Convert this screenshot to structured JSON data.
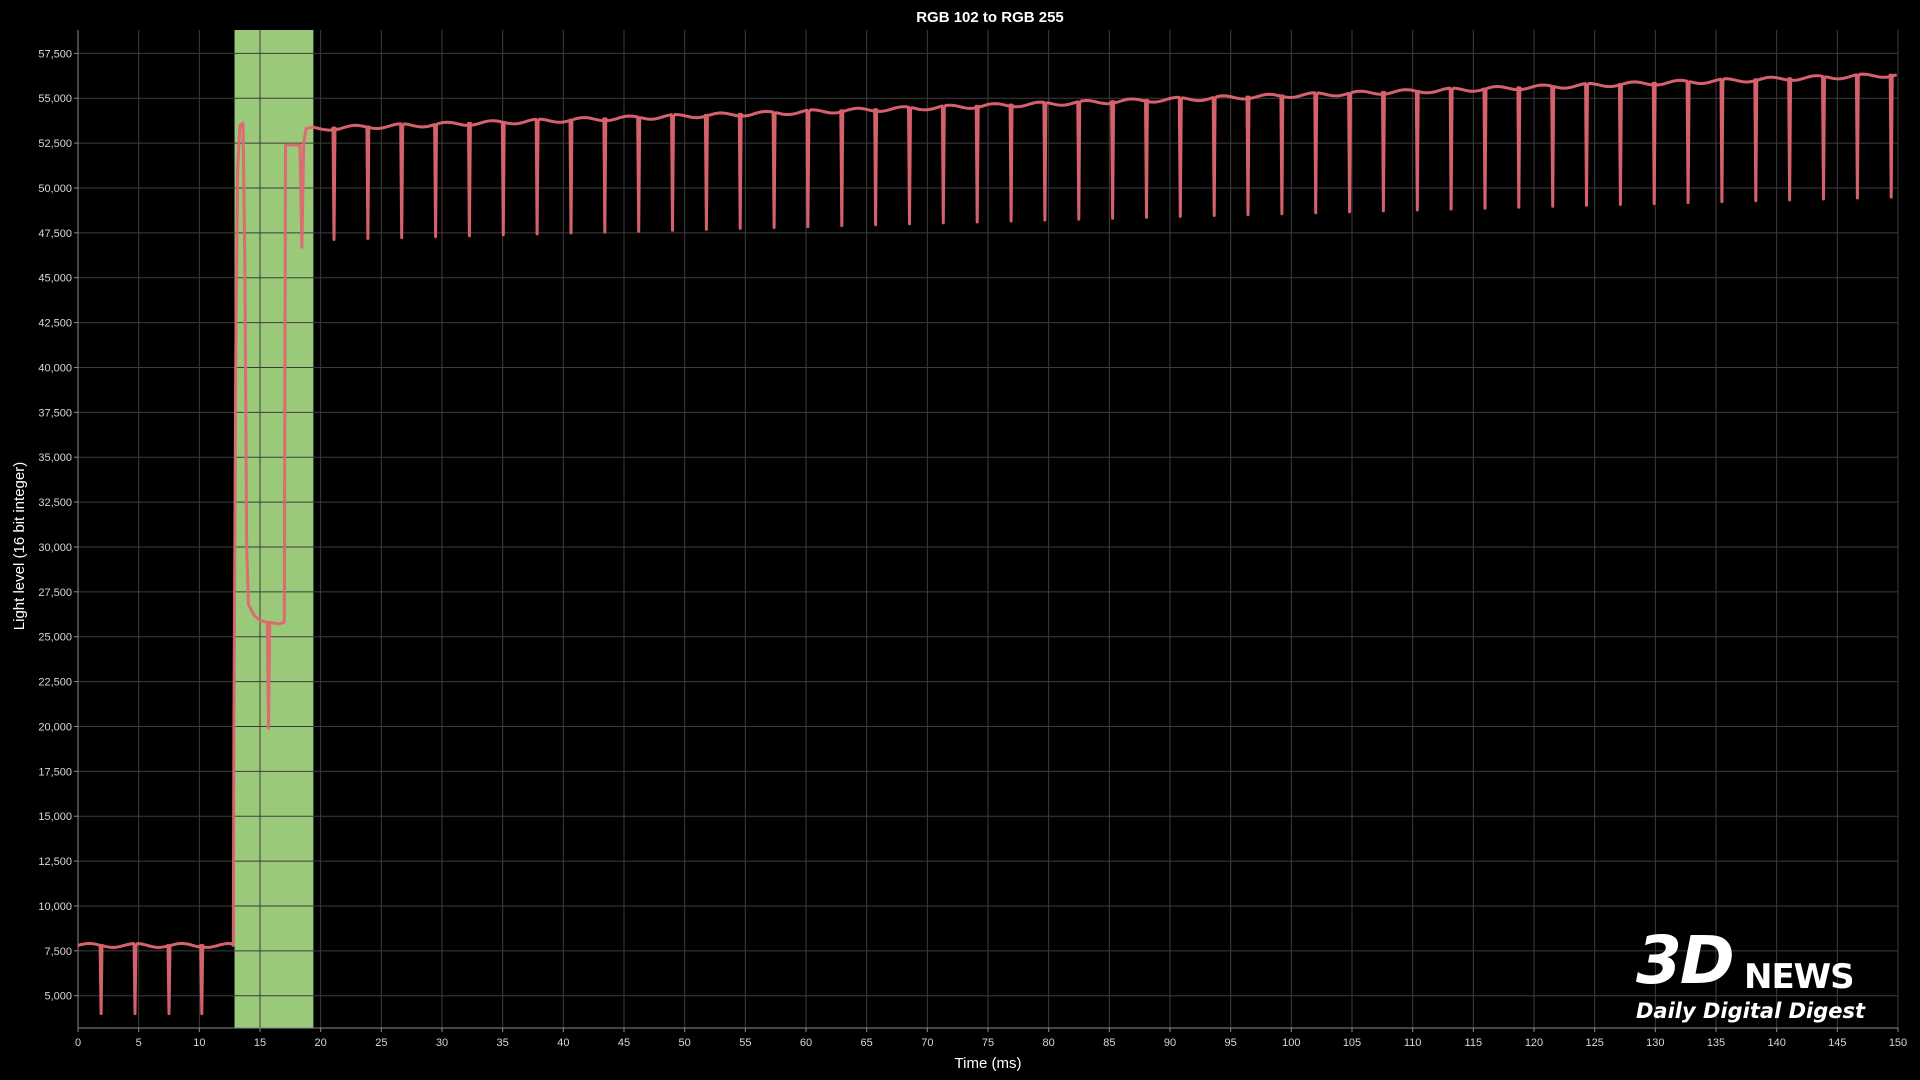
{
  "chart_data": {
    "type": "line",
    "title": "RGB 102 to RGB 255",
    "xlabel": "Time (ms)",
    "ylabel": "Light level (16 bit integer)",
    "xlim": [
      0,
      150
    ],
    "ylim": [
      3200,
      58800
    ],
    "x_ticks": [
      0,
      5,
      10,
      15,
      20,
      25,
      30,
      35,
      40,
      45,
      50,
      55,
      60,
      65,
      70,
      75,
      80,
      85,
      90,
      95,
      100,
      105,
      110,
      115,
      120,
      125,
      130,
      135,
      140,
      145,
      150
    ],
    "y_ticks": [
      5000,
      7500,
      10000,
      12500,
      15000,
      17500,
      20000,
      22500,
      25000,
      27500,
      30000,
      32500,
      35000,
      37500,
      40000,
      42500,
      45000,
      47500,
      50000,
      52500,
      55000,
      57500
    ],
    "y_tick_labels": [
      "5,000",
      "7,500",
      "10,000",
      "12,500",
      "15,000",
      "17,500",
      "20,000",
      "22,500",
      "25,000",
      "27,500",
      "30,000",
      "32,500",
      "35,000",
      "37,500",
      "40,000",
      "42,500",
      "45,000",
      "47,500",
      "50,000",
      "52,500",
      "55,000",
      "57,500"
    ],
    "grid": true,
    "highlight_region": {
      "x_start": 12.9,
      "x_end": 19.4,
      "color": "#9bc97a"
    },
    "series": [
      {
        "color": "#e06672",
        "before": {
          "x_start": 0,
          "x_end": 12.8,
          "level": 7800,
          "dips": [
            {
              "x": 1.9,
              "y": 4000
            },
            {
              "x": 4.7,
              "y": 4000
            },
            {
              "x": 7.5,
              "y": 4000
            },
            {
              "x": 10.2,
              "y": 4000
            }
          ]
        },
        "transition": [
          {
            "x": 12.8,
            "y": 7800
          },
          {
            "x": 12.85,
            "y": 20000
          },
          {
            "x": 13.0,
            "y": 40000
          },
          {
            "x": 13.15,
            "y": 51000
          },
          {
            "x": 13.35,
            "y": 53500
          },
          {
            "x": 13.6,
            "y": 53600
          },
          {
            "x": 13.75,
            "y": 46000
          },
          {
            "x": 13.9,
            "y": 30000
          },
          {
            "x": 14.05,
            "y": 26800
          },
          {
            "x": 14.5,
            "y": 26200
          },
          {
            "x": 15.0,
            "y": 25900
          },
          {
            "x": 15.6,
            "y": 25800
          },
          {
            "x": 15.7,
            "y": 19900
          },
          {
            "x": 15.8,
            "y": 25800
          },
          {
            "x": 16.5,
            "y": 25700
          },
          {
            "x": 17.0,
            "y": 25800
          },
          {
            "x": 17.1,
            "y": 52400
          },
          {
            "x": 18.3,
            "y": 52400
          },
          {
            "x": 18.45,
            "y": 46700
          },
          {
            "x": 18.6,
            "y": 52500
          },
          {
            "x": 18.8,
            "y": 53300
          },
          {
            "x": 19.4,
            "y": 53400
          }
        ],
        "after": {
          "x_start": 19.4,
          "x_end": 150,
          "level_start": 53300,
          "level_end": 56300,
          "dip_start": 21.1,
          "dip_spacing": 2.79,
          "dip_depth_start": 47100,
          "dip_depth_end": 49500
        }
      }
    ]
  },
  "watermark": {
    "mark": "3D",
    "word": "NEWS",
    "tagline": "Daily Digital Digest"
  }
}
